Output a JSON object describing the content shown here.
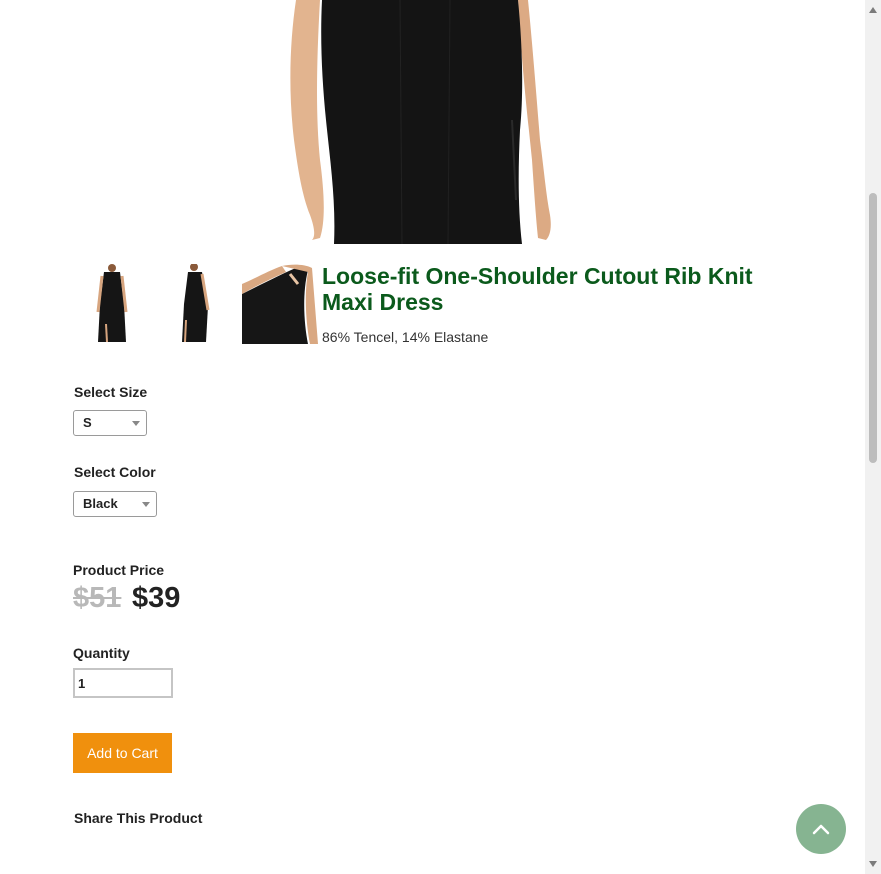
{
  "product": {
    "title": "Loose-fit One-Shoulder Cutout Rib Knit Maxi Dress",
    "material": "86% Tencel, 14% Elastane"
  },
  "size": {
    "label": "Select Size",
    "selected": "S"
  },
  "color": {
    "label": "Select Color",
    "selected": "Black"
  },
  "price": {
    "label": "Product Price",
    "original": "$51",
    "current": "$39"
  },
  "quantity": {
    "label": "Quantity",
    "value": "1"
  },
  "cart": {
    "button_label": "Add to Cart"
  },
  "share": {
    "label": "Share This Product"
  },
  "colors": {
    "title": "#0b5a1c",
    "add_to_cart": "#f0900d",
    "back_to_top": "#86b491",
    "old_price": "#b8b8b8"
  },
  "icons": {
    "back_to_top": "chevron-up-icon"
  }
}
